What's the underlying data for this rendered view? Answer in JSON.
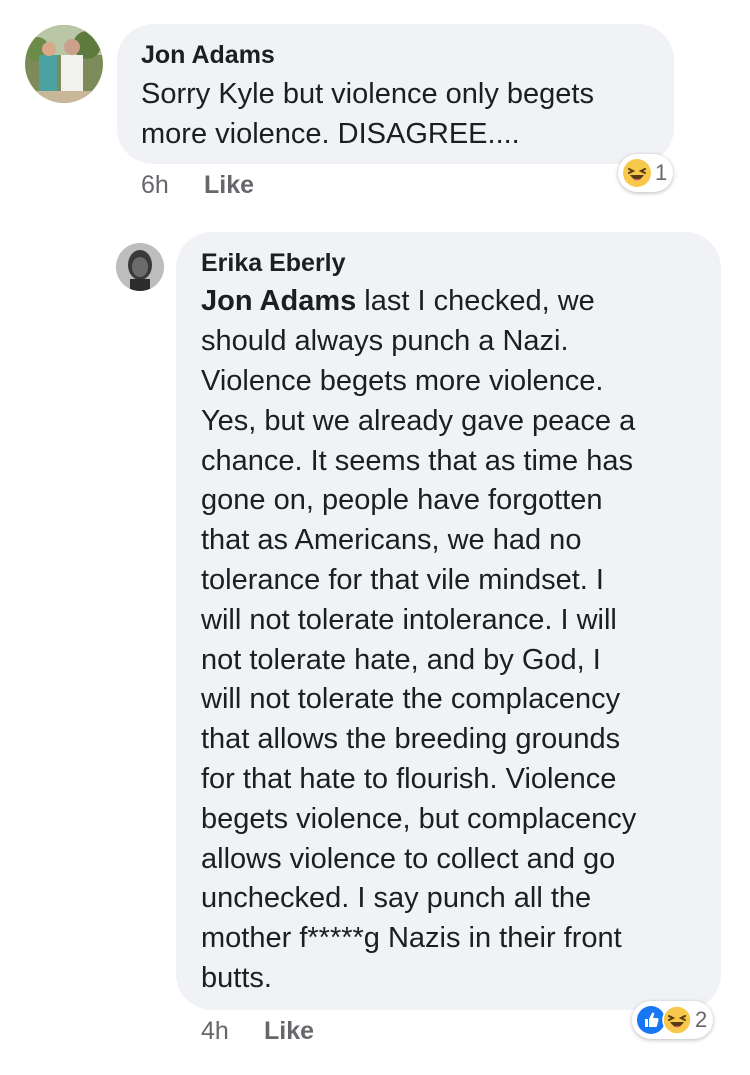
{
  "comments": [
    {
      "author": "Jon Adams",
      "lines": [
        "Sorry Kyle but violence only begets",
        "more violence.  DISAGREE...."
      ],
      "time": "6h",
      "like_label": "Like",
      "reactions": {
        "icons": [
          "haha-icon"
        ],
        "count": "1"
      }
    },
    {
      "author": "Erika Eberly",
      "mention": "Jon Adams",
      "first_line_rest": " last I checked, we",
      "lines": [
        "should always punch a Nazi.",
        "Violence begets more violence.",
        "Yes, but we already gave peace a",
        "chance. It seems that as time has",
        "gone on, people have forgotten",
        "that as Americans, we had no",
        "tolerance for that vile mindset. I",
        "will not tolerate intolerance. I will",
        "not tolerate hate, and by God, I",
        "will not tolerate the complacency",
        "that allows the breeding grounds",
        "for that hate to flourish. Violence",
        "begets violence, but complacency",
        "allows violence to collect and go",
        "unchecked. I say punch all the",
        "mother f*****g Nazis in their front",
        "butts."
      ],
      "time": "4h",
      "like_label": "Like",
      "reactions": {
        "icons": [
          "like-icon",
          "haha-icon"
        ],
        "count": "2"
      }
    }
  ],
  "colors": {
    "bubble": "#f0f2f5",
    "meta": "#65676b",
    "like_blue": "#1877f2",
    "haha_yellow": "#f7c84b"
  }
}
